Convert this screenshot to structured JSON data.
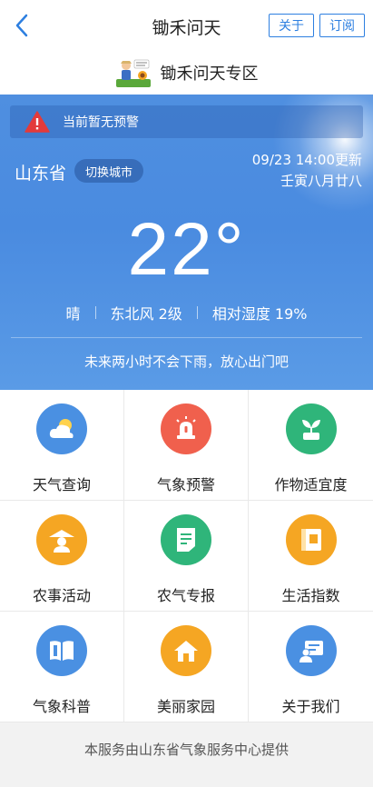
{
  "nav": {
    "title": "锄禾问天",
    "about_label": "关于",
    "subscribe_label": "订阅"
  },
  "header": {
    "zone_title": "锄禾问天专区"
  },
  "weather": {
    "alert_text": "当前暂无预警",
    "province": "山东省",
    "switch_city_label": "切换城市",
    "updated": "09/23 14:00更新",
    "lunar_date": "壬寅八月廿八",
    "temperature": "22°",
    "condition": "晴",
    "wind": "东北风 2级",
    "humidity": "相对湿度 19%",
    "forecast_text": "未来两小时不会下雨，放心出门吧"
  },
  "grid": {
    "items": [
      {
        "label": "天气查询",
        "icon": "cloud-sun-icon",
        "color": "#4a90e2"
      },
      {
        "label": "气象预警",
        "icon": "alarm-siren-icon",
        "color": "#f0604d"
      },
      {
        "label": "作物适宜度",
        "icon": "sprout-icon",
        "color": "#2fb57a"
      },
      {
        "label": "农事活动",
        "icon": "farmer-hat-icon",
        "color": "#f5a623"
      },
      {
        "label": "农气专报",
        "icon": "document-icon",
        "color": "#2fb57a"
      },
      {
        "label": "生活指数",
        "icon": "book-index-icon",
        "color": "#f5a623"
      },
      {
        "label": "气象科普",
        "icon": "open-book-icon",
        "color": "#4a90e2"
      },
      {
        "label": "美丽家园",
        "icon": "home-icon",
        "color": "#f5a623"
      },
      {
        "label": "关于我们",
        "icon": "contact-card-icon",
        "color": "#4a90e2"
      }
    ]
  },
  "footer": {
    "text": "本服务由山东省气象服务中心提供"
  }
}
